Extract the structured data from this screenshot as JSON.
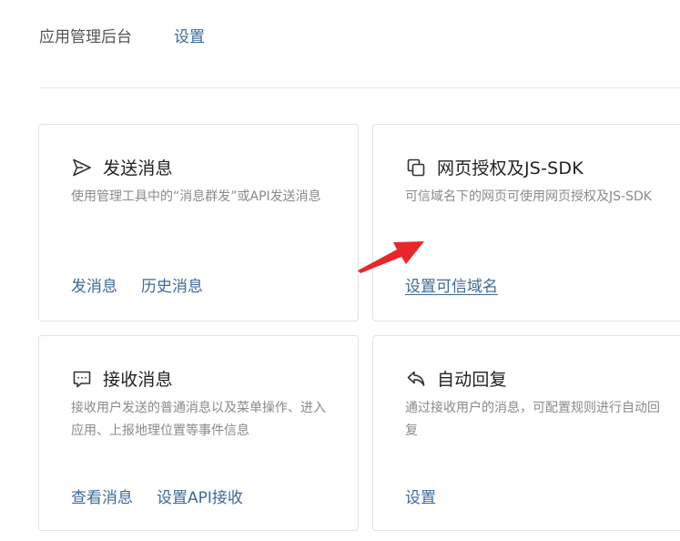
{
  "header": {
    "app_title": "应用管理后台",
    "settings_link": "设置"
  },
  "cards": [
    {
      "title": "发送消息",
      "icon": "send-icon",
      "desc": "使用管理工具中的“消息群发”或API发送消息",
      "links": [
        "发消息",
        "历史消息"
      ]
    },
    {
      "title": "网页授权及JS-SDK",
      "icon": "web-auth-icon",
      "desc": "可信域名下的网页可使用网页授权及JS-SDK",
      "links": [
        "设置可信域名"
      ]
    },
    {
      "title": "接收消息",
      "icon": "chat-icon",
      "desc": "接收用户发送的普通消息以及菜单操作、进入应用、上报地理位置等事件信息",
      "links": [
        "查看消息",
        "设置API接收"
      ]
    },
    {
      "title": "自动回复",
      "icon": "reply-icon",
      "desc": "通过接收用户的消息，可配置规则进行自动回复",
      "links": [
        "设置"
      ]
    }
  ],
  "colors": {
    "link": "#3e6a99",
    "annotation_arrow": "#e8272b"
  }
}
